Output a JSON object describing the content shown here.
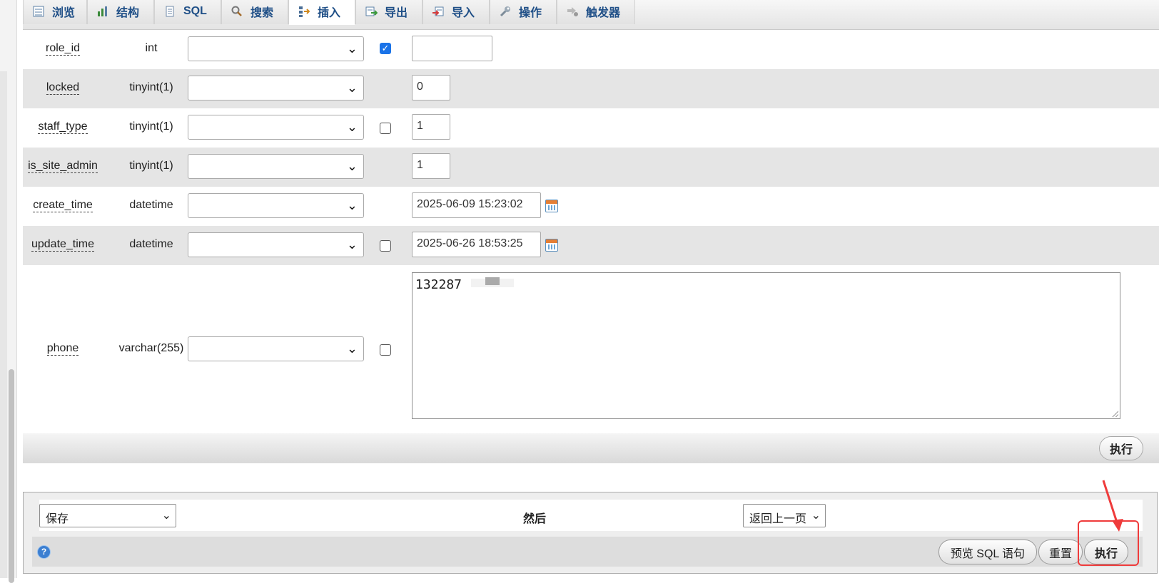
{
  "tabs": [
    {
      "label": "浏览",
      "icon": "browse-icon"
    },
    {
      "label": "结构",
      "icon": "structure-icon"
    },
    {
      "label": "SQL",
      "icon": "sql-icon"
    },
    {
      "label": "搜索",
      "icon": "search-icon"
    },
    {
      "label": "插入",
      "icon": "insert-icon",
      "active": true
    },
    {
      "label": "导出",
      "icon": "export-icon"
    },
    {
      "label": "导入",
      "icon": "import-icon"
    },
    {
      "label": "操作",
      "icon": "wrench-icon"
    },
    {
      "label": "触发器",
      "icon": "trigger-icon"
    }
  ],
  "fields": [
    {
      "name": "role_id",
      "type": "int",
      "function": "",
      "null_checked": true,
      "value": ""
    },
    {
      "name": "locked",
      "type": "tinyint(1)",
      "function": "",
      "null_checkbox": false,
      "value": "0"
    },
    {
      "name": "staff_type",
      "type": "tinyint(1)",
      "function": "",
      "null_checked": false,
      "value": "1"
    },
    {
      "name": "is_site_admin",
      "type": "tinyint(1)",
      "function": "",
      "null_checkbox": false,
      "value": "1"
    },
    {
      "name": "create_time",
      "type": "datetime",
      "function": "",
      "null_checkbox": false,
      "value": "2025-06-09 15:23:02"
    },
    {
      "name": "update_time",
      "type": "datetime",
      "function": "",
      "null_checked": false,
      "value": "2025-06-26 18:53:25"
    },
    {
      "name": "phone",
      "type": "varchar(255)",
      "function": "",
      "null_checked": false,
      "value": "132287"
    }
  ],
  "go_button_label": "执行",
  "after_insert": {
    "action_select": "保存",
    "then_label": "然后",
    "next_select": "返回上一页"
  },
  "footer_buttons": {
    "preview_sql": "预览 SQL 语句",
    "reset": "重置",
    "execute": "执行"
  },
  "colors": {
    "tab_text": "#1f4f87",
    "row_alt": "#e5e5e5",
    "checkbox_checked": "#1a73e8",
    "annotation": "#ef3b3b"
  }
}
